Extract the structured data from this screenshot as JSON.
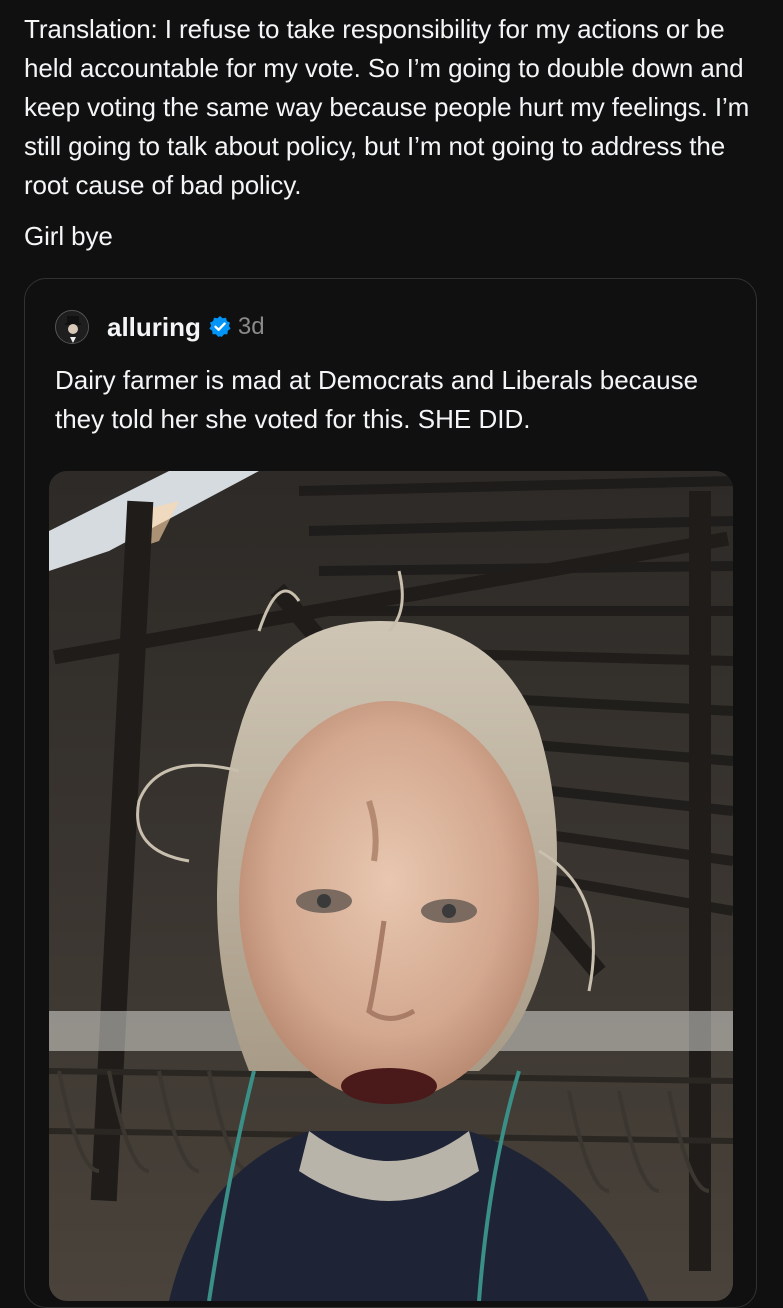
{
  "post": {
    "paragraphs": [
      "Translation: I refuse to take responsibility for my actions or be held accountable for my vote. So I’m going to double down and keep voting the same way because people hurt my feelings. I’m still going to talk about policy, but I’m not going to address the root cause of bad policy.",
      "Girl bye"
    ]
  },
  "quoted_post": {
    "avatar_icon": "user-avatar",
    "username": "alluring",
    "verified_icon": "verified-badge-icon",
    "verified_color": "#0095f6",
    "time": "3d",
    "text": "Dairy farmer is mad at Democrats and Liberals because they told her she voted for this. SHE DID.",
    "media_description_icon": "video-thumbnail"
  }
}
